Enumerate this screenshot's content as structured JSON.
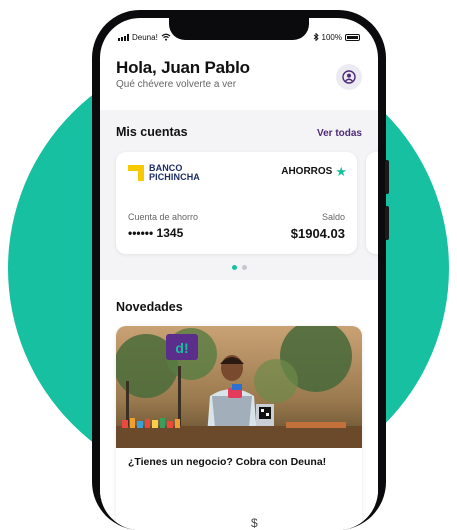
{
  "status_bar": {
    "carrier": "Deuna!",
    "battery": "100%"
  },
  "header": {
    "greeting": "Hola, Juan Pablo",
    "subtitle": "Qué chévere volverte a ver"
  },
  "accounts": {
    "title": "Mis cuentas",
    "see_all": "Ver todas",
    "card": {
      "bank_line1": "BANCO",
      "bank_line2": "PICHINCHA",
      "type": "AHORROS",
      "account_label": "Cuenta de ahorro",
      "account_number": "•••••• 1345",
      "balance_label": "Saldo",
      "balance": "$1904.03"
    }
  },
  "news": {
    "title": "Novedades",
    "card_text": "¿Tienes un negocio? Cobra con Deuna!",
    "sign_text": "d!"
  },
  "colors": {
    "accent": "#16c0a0",
    "purple": "#4d2a7a",
    "bank_blue": "#1c2d63",
    "bank_yellow": "#f6c900"
  }
}
